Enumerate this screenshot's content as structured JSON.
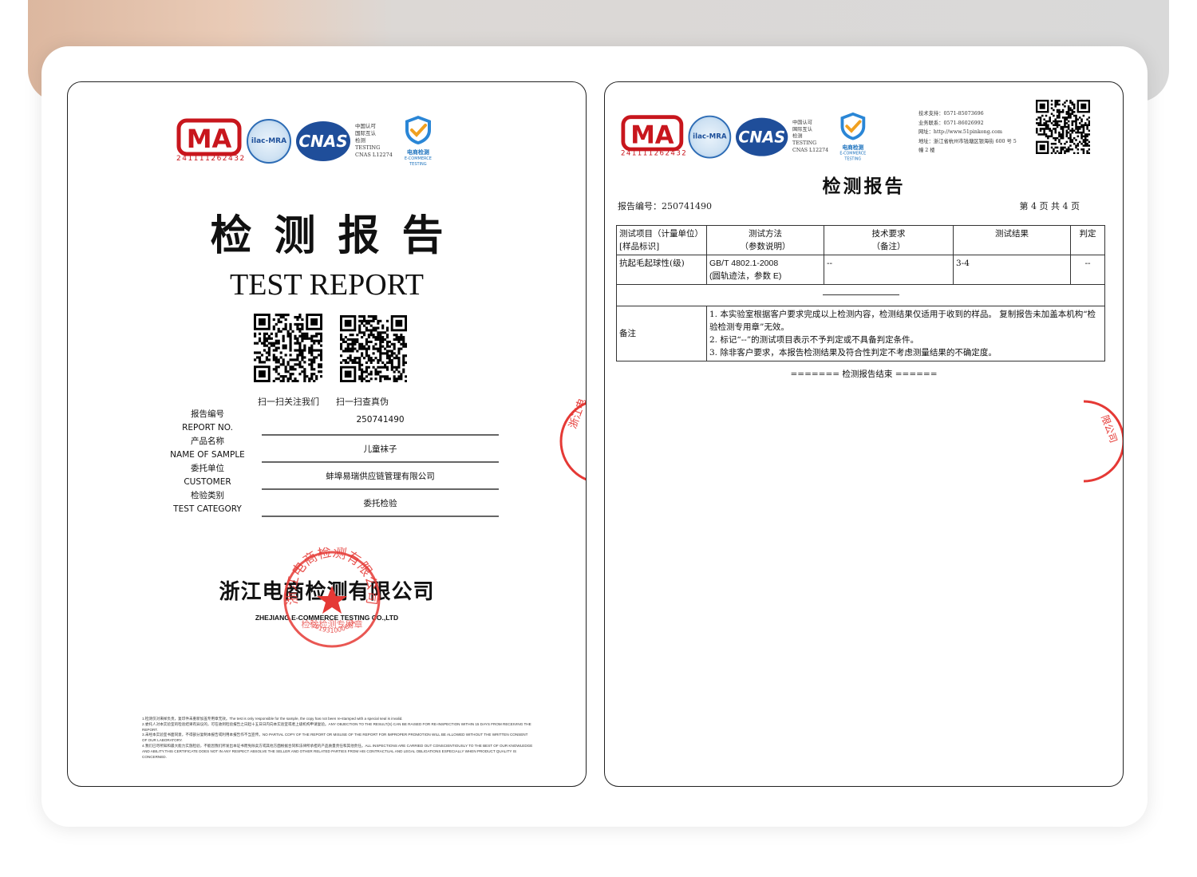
{
  "left": {
    "cma_number": "241111262432",
    "ilac_label": "ilac-MRA",
    "cnas_label": "CNAS",
    "cert_text": [
      "中国认可",
      "国际互认",
      "检测",
      "TESTING",
      "CNAS L12274"
    ],
    "ec_label_cn": "电商检测",
    "ec_label_en": "E-COMMERCE TESTING",
    "title_cn": "检测报告",
    "title_en": "TEST REPORT",
    "qr_captions": [
      "扫一扫关注我们",
      "扫一扫查真伪"
    ],
    "fields": [
      {
        "label_cn": "报告编号",
        "label_en": "REPORT NO.",
        "value": "250741490"
      },
      {
        "label_cn": "产品名称",
        "label_en": "NAME OF SAMPLE",
        "value": "儿童袜子"
      },
      {
        "label_cn": "委托单位",
        "label_en": "CUSTOMER",
        "value": "蚌埠易瑞供应链管理有限公司"
      },
      {
        "label_cn": "检验类别",
        "label_en": "TEST CATEGORY",
        "value": "委托检验"
      }
    ],
    "company_cn": "浙江电商检测有限公司",
    "company_en": "ZHEJIANG E-COMMERCE TESTING CO.,LTD",
    "seal": {
      "text": "浙江电商检测有限公司",
      "sub": "检验检测专用章",
      "number": "3301931000684"
    },
    "fine_print": [
      "1.检测仅对来样负责，复印件未重新加盖专用章无效。The test is only responsible for the sample, the copy has not been re-stamped with a special seal is invalid.",
      "2.委托人对本实验室的检验结果有异议的，可在收到检验报告之日起十五日日内向本实验室或者上级机构申请复验。ANY OBJECTION TO THE RESULT(S) CAN BE RAISED FOR RE-INSPECTION WITHIN 15 DAYS FROM RECEIVING THE REPORT.",
      "3.未经本实验室书面同意，不得部分复制本报告或利用本报告作不当宣传。NO PARTIAL COPY OF THE REPORT OR MISUSE OF THE REPORT FOR IMPROPER PROMOTION WILL BE ALLOWED WITHOUT THE WRITTEN CONSENT OF OUR LABORATORY.",
      "4.我们已尽所知和最大能力实施检验，不能因我们所发出本证书而免除卖方或其他方面根据合同和法律所承担的产品质量责任和其他责任。ALL INSPECTIONS ARE CARRIED OUT CONSCIENTIOUSLY TO THE BEST OF OUR KNOWLEDGE AND ABILITY.THIS CERTIFICATE DOES NOT IN ANY RESPECT ABSOLVE THE SELLER AND OTHER RELATED PARTIES FROM HIS CONTRACTUAL AND LEGAL OBLIGATIONS ESPECIALLY WHEN PRODUCT QUALITY IS CONCERNED."
    ]
  },
  "right": {
    "cma_number": "241111262432",
    "ilac_label": "ilac-MRA",
    "cnas_label": "CNAS",
    "cert_text": [
      "中国认可",
      "国际互认",
      "检测",
      "TESTING",
      "CNAS L12274"
    ],
    "ec_label_cn": "电商检测",
    "ec_label_en": "E-COMMERCE TESTING",
    "contact": [
      "技术支持：0571-85073696",
      "业务联系：0571-86026992",
      "网址：http://www.51pinkong.com",
      "地址：浙江省杭州市钱塘区银海街 600 号 5",
      "幢 2 楼"
    ],
    "title": "检测报告",
    "report_no": "报告编号：250741490",
    "page_info": "第 4 页 共 4 页",
    "headers": [
      [
        "测试项目（计量单位）",
        "[样品标识]"
      ],
      [
        "测试方法",
        "（参数说明）"
      ],
      [
        "技术要求",
        "（备注）"
      ],
      [
        "测试结果",
        ""
      ],
      [
        "判定",
        ""
      ]
    ],
    "row": {
      "item": "抗起毛起球性(级)",
      "method_line1": "GB/T  4802.1-2008",
      "method_line2": "(圆轨迹法，参数 E)",
      "requirement": "--",
      "result": "3-4",
      "judgement": "--"
    },
    "remark_label": "备注",
    "remarks": [
      "1.    本实验室根据客户要求完成以上检测内容，检测结果仅适用于收到的样品。 复制报告未加盖本机构“检验检测专用章”无效。",
      "2.    标记“--”的测试项目表示不予判定或不具备判定条件。",
      "3.    除非客户要求，本报告检测结果及符合性判定不考虑测量结果的不确定度。"
    ],
    "end_text": "======= 检测报告结束 ======"
  },
  "colors": {
    "brand_red": "#c8161d",
    "brand_blue": "#1f4e9a",
    "seal_red": "#e53935"
  }
}
